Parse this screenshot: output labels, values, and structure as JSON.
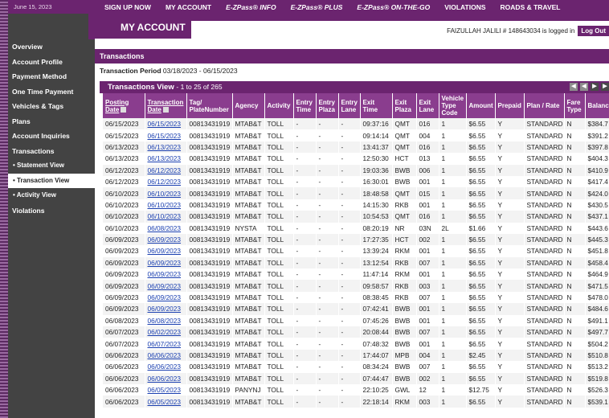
{
  "date": "June 15, 2023",
  "nav": [
    "SIGN UP NOW",
    "MY ACCOUNT",
    "E-ZPass® INFO",
    "E-ZPass® PLUS",
    "E-ZPass® ON-THE-GO",
    "VIOLATIONS",
    "ROADS & TRAVEL"
  ],
  "header": {
    "title": "MY ACCOUNT",
    "logged_in": "FAIZULLAH JALILI # 148643034 is logged in",
    "logout": "Log Out"
  },
  "sidebar": [
    {
      "label": "Overview",
      "sub": false,
      "active": false
    },
    {
      "label": "Account Profile",
      "sub": false,
      "active": false
    },
    {
      "label": "Payment Method",
      "sub": false,
      "active": false
    },
    {
      "label": "One Time Payment",
      "sub": false,
      "active": false
    },
    {
      "label": "Vehicles & Tags",
      "sub": false,
      "active": false
    },
    {
      "label": "Plans",
      "sub": false,
      "active": false
    },
    {
      "label": "Account Inquiries",
      "sub": false,
      "active": false
    },
    {
      "label": "Transactions",
      "sub": false,
      "active": false
    },
    {
      "label": "• Statement View",
      "sub": true,
      "active": false
    },
    {
      "label": "• Transaction View",
      "sub": true,
      "active": true
    },
    {
      "label": "• Activity View",
      "sub": true,
      "active": false
    },
    {
      "label": "Violations",
      "sub": false,
      "active": false
    }
  ],
  "section_title": "Transactions",
  "period_label": "Transaction Period",
  "period_value": "03/18/2023 - 06/15/2023",
  "view_title": "Transactions View",
  "view_count": "- 1 to 25 of 265",
  "columns": [
    "Posting Date",
    "Transaction Date",
    "Tag/ PlateNumber",
    "Agency",
    "Activity",
    "Entry Time",
    "Entry Plaza",
    "Entry Lane",
    "Exit Time",
    "Exit Plaza",
    "Exit Lane",
    "Vehicle Type Code",
    "Amount",
    "Prepaid",
    "Plan / Rate",
    "Fare Type",
    "Balance"
  ],
  "rows": [
    [
      "06/15/2023",
      "06/15/2023",
      "00813431919",
      "MTAB&T",
      "TOLL",
      "-",
      "-",
      "-",
      "09:37:16",
      "QMT",
      "016",
      "1",
      "$6.55",
      "Y",
      "STANDARD",
      "N",
      "$384.7"
    ],
    [
      "06/15/2023",
      "06/15/2023",
      "00813431919",
      "MTAB&T",
      "TOLL",
      "-",
      "-",
      "-",
      "09:14:14",
      "QMT",
      "004",
      "1",
      "$6.55",
      "Y",
      "STANDARD",
      "N",
      "$391.2"
    ],
    [
      "06/13/2023",
      "06/13/2023",
      "00813431919",
      "MTAB&T",
      "TOLL",
      "-",
      "-",
      "-",
      "13:41:37",
      "QMT",
      "016",
      "1",
      "$6.55",
      "Y",
      "STANDARD",
      "N",
      "$397.8"
    ],
    [
      "06/13/2023",
      "06/13/2023",
      "00813431919",
      "MTAB&T",
      "TOLL",
      "-",
      "-",
      "-",
      "12:50:30",
      "HCT",
      "013",
      "1",
      "$6.55",
      "Y",
      "STANDARD",
      "N",
      "$404.3"
    ],
    [
      "06/12/2023",
      "06/12/2023",
      "00813431919",
      "MTAB&T",
      "TOLL",
      "-",
      "-",
      "-",
      "19:03:36",
      "BWB",
      "006",
      "1",
      "$6.55",
      "Y",
      "STANDARD",
      "N",
      "$410.9"
    ],
    [
      "06/12/2023",
      "06/12/2023",
      "00813431919",
      "MTAB&T",
      "TOLL",
      "-",
      "-",
      "-",
      "16:30:01",
      "BWB",
      "001",
      "1",
      "$6.55",
      "Y",
      "STANDARD",
      "N",
      "$417.4"
    ],
    [
      "06/10/2023",
      "06/10/2023",
      "00813431919",
      "MTAB&T",
      "TOLL",
      "-",
      "-",
      "-",
      "18:48:58",
      "QMT",
      "015",
      "1",
      "$6.55",
      "Y",
      "STANDARD",
      "N",
      "$424.0"
    ],
    [
      "06/10/2023",
      "06/10/2023",
      "00813431919",
      "MTAB&T",
      "TOLL",
      "-",
      "-",
      "-",
      "14:15:30",
      "RKB",
      "001",
      "1",
      "$6.55",
      "Y",
      "STANDARD",
      "N",
      "$430.5"
    ],
    [
      "06/10/2023",
      "06/10/2023",
      "00813431919",
      "MTAB&T",
      "TOLL",
      "-",
      "-",
      "-",
      "10:54:53",
      "QMT",
      "016",
      "1",
      "$6.55",
      "Y",
      "STANDARD",
      "N",
      "$437.1"
    ],
    [
      "06/10/2023",
      "06/08/2023",
      "00813431919",
      "NYSTA",
      "TOLL",
      "-",
      "-",
      "-",
      "08:20:19",
      "NR",
      "03N",
      "2L",
      "$1.66",
      "Y",
      "STANDARD",
      "N",
      "$443.6"
    ],
    [
      "06/09/2023",
      "06/09/2023",
      "00813431919",
      "MTAB&T",
      "TOLL",
      "-",
      "-",
      "-",
      "17:27:35",
      "HCT",
      "002",
      "1",
      "$6.55",
      "Y",
      "STANDARD",
      "N",
      "$445.3"
    ],
    [
      "06/09/2023",
      "06/09/2023",
      "00813431919",
      "MTAB&T",
      "TOLL",
      "-",
      "-",
      "-",
      "13:39:24",
      "RKM",
      "001",
      "1",
      "$6.55",
      "Y",
      "STANDARD",
      "N",
      "$451.8"
    ],
    [
      "06/09/2023",
      "06/09/2023",
      "00813431919",
      "MTAB&T",
      "TOLL",
      "-",
      "-",
      "-",
      "13:12:54",
      "RKB",
      "007",
      "1",
      "$6.55",
      "Y",
      "STANDARD",
      "N",
      "$458.4"
    ],
    [
      "06/09/2023",
      "06/09/2023",
      "00813431919",
      "MTAB&T",
      "TOLL",
      "-",
      "-",
      "-",
      "11:47:14",
      "RKM",
      "001",
      "1",
      "$6.55",
      "Y",
      "STANDARD",
      "N",
      "$464.9"
    ],
    [
      "06/09/2023",
      "06/09/2023",
      "00813431919",
      "MTAB&T",
      "TOLL",
      "-",
      "-",
      "-",
      "09:58:57",
      "RKB",
      "003",
      "1",
      "$6.55",
      "Y",
      "STANDARD",
      "N",
      "$471.5"
    ],
    [
      "06/09/2023",
      "06/09/2023",
      "00813431919",
      "MTAB&T",
      "TOLL",
      "-",
      "-",
      "-",
      "08:38:45",
      "RKB",
      "007",
      "1",
      "$6.55",
      "Y",
      "STANDARD",
      "N",
      "$478.0"
    ],
    [
      "06/09/2023",
      "06/09/2023",
      "00813431919",
      "MTAB&T",
      "TOLL",
      "-",
      "-",
      "-",
      "07:42:41",
      "BWB",
      "001",
      "1",
      "$6.55",
      "Y",
      "STANDARD",
      "N",
      "$484.6"
    ],
    [
      "06/08/2023",
      "06/08/2023",
      "00813431919",
      "MTAB&T",
      "TOLL",
      "-",
      "-",
      "-",
      "07:45:26",
      "BWB",
      "001",
      "1",
      "$6.55",
      "Y",
      "STANDARD",
      "N",
      "$491.1"
    ],
    [
      "06/07/2023",
      "06/02/2023",
      "00813431919",
      "MTAB&T",
      "TOLL",
      "-",
      "-",
      "-",
      "20:08:44",
      "BWB",
      "007",
      "1",
      "$6.55",
      "Y",
      "STANDARD",
      "N",
      "$497.7"
    ],
    [
      "06/07/2023",
      "06/07/2023",
      "00813431919",
      "MTAB&T",
      "TOLL",
      "-",
      "-",
      "-",
      "07:48:32",
      "BWB",
      "001",
      "1",
      "$6.55",
      "Y",
      "STANDARD",
      "N",
      "$504.2"
    ],
    [
      "06/06/2023",
      "06/06/2023",
      "00813431919",
      "MTAB&T",
      "TOLL",
      "-",
      "-",
      "-",
      "17:44:07",
      "MPB",
      "004",
      "1",
      "$2.45",
      "Y",
      "STANDARD",
      "N",
      "$510.8"
    ],
    [
      "06/06/2023",
      "06/06/2023",
      "00813431919",
      "MTAB&T",
      "TOLL",
      "-",
      "-",
      "-",
      "08:34:24",
      "BWB",
      "007",
      "1",
      "$6.55",
      "Y",
      "STANDARD",
      "N",
      "$513.2"
    ],
    [
      "06/06/2023",
      "06/06/2023",
      "00813431919",
      "MTAB&T",
      "TOLL",
      "-",
      "-",
      "-",
      "07:44:47",
      "BWB",
      "002",
      "1",
      "$6.55",
      "Y",
      "STANDARD",
      "N",
      "$519.8"
    ],
    [
      "06/06/2023",
      "06/05/2023",
      "00813431919",
      "PANYNJ",
      "TOLL",
      "-",
      "-",
      "-",
      "22:10:25",
      "GWL",
      "12",
      "1",
      "$12.75",
      "Y",
      "STANDARD",
      "N",
      "$526.3"
    ],
    [
      "06/06/2023",
      "06/05/2023",
      "00813431919",
      "MTAB&T",
      "TOLL",
      "-",
      "-",
      "-",
      "22:18:14",
      "RKM",
      "003",
      "1",
      "$6.55",
      "Y",
      "STANDARD",
      "N",
      "$539.1"
    ]
  ]
}
